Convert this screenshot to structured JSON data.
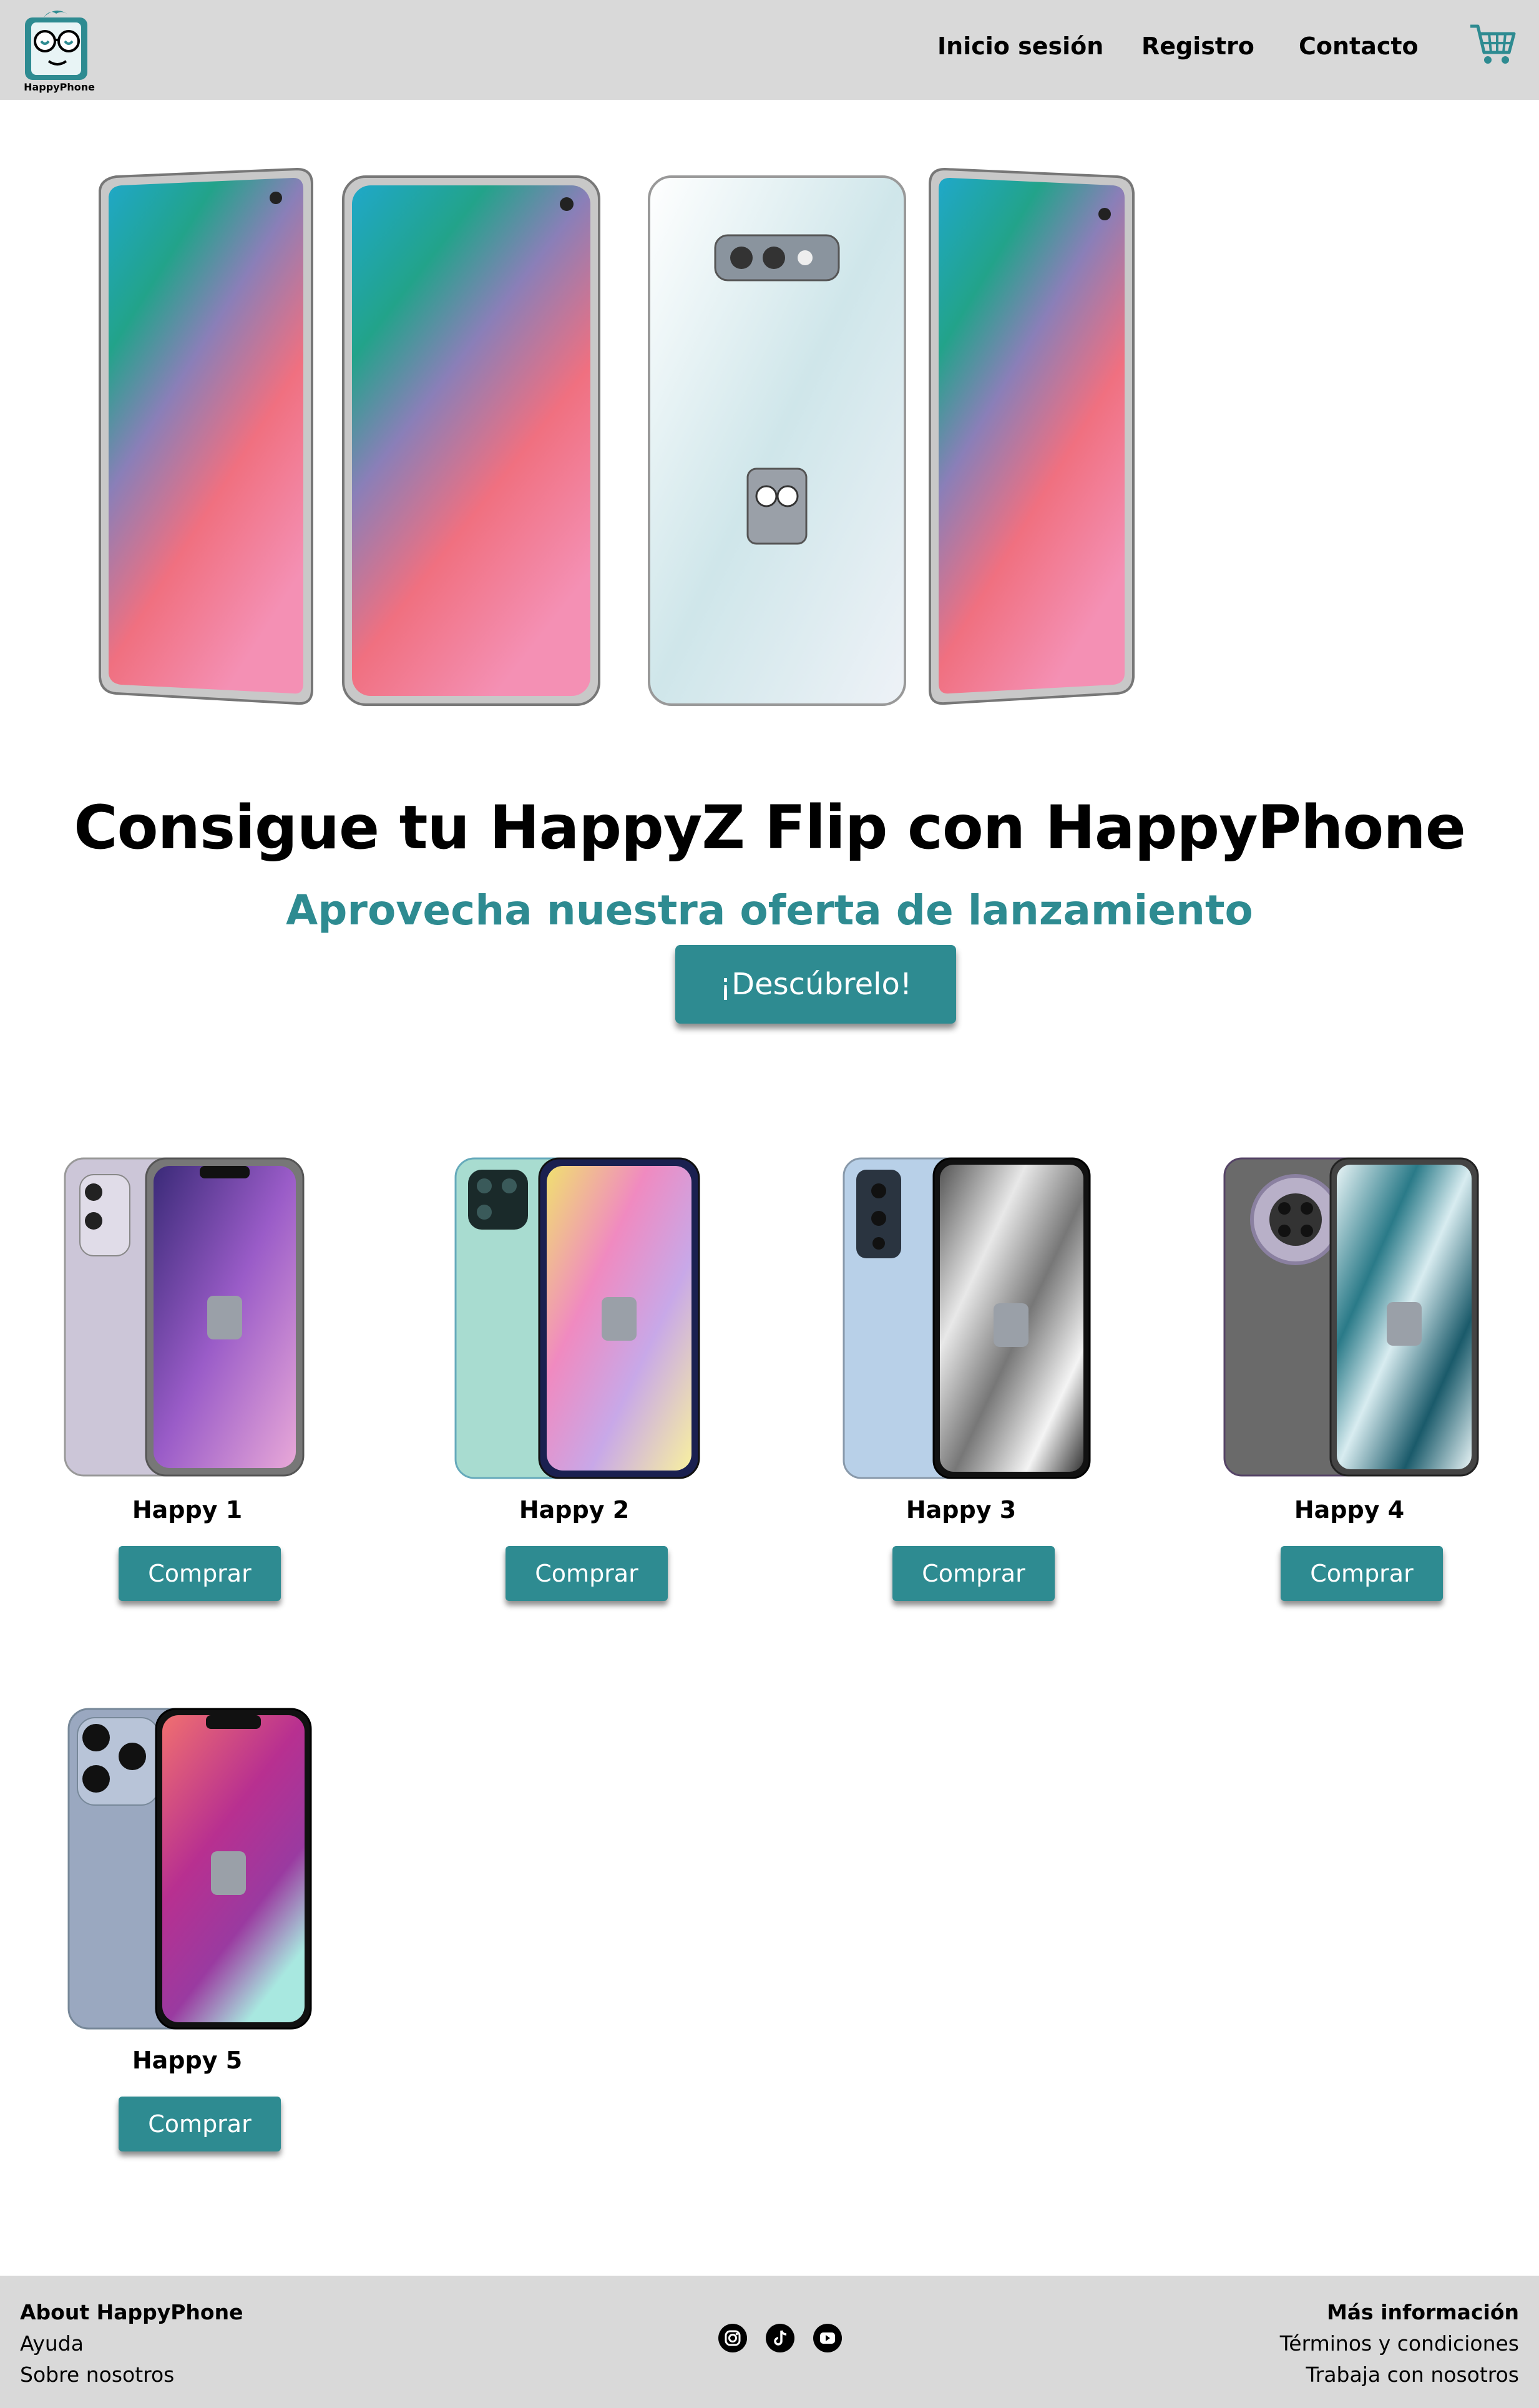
{
  "header": {
    "logo_text": "HappyPhone",
    "nav": [
      "Inicio sesión",
      "Registro",
      "Contacto"
    ],
    "cart_icon": "shopping-cart-icon",
    "accent": "#2e8b91"
  },
  "hero": {
    "title": "Consigue tu HappyZ Flip con HappyPhone",
    "subtitle": "Aprovecha nuestra oferta de lanzamiento",
    "cta": "¡Descúbrelo!"
  },
  "products": [
    {
      "name": "Happy 1",
      "button": "Comprar"
    },
    {
      "name": "Happy 2",
      "button": "Comprar"
    },
    {
      "name": "Happy 3",
      "button": "Comprar"
    },
    {
      "name": "Happy 4",
      "button": "Comprar"
    },
    {
      "name": "Happy 5",
      "button": "Comprar"
    }
  ],
  "footer": {
    "left_heading": "About HappyPhone",
    "left_links": [
      "Ayuda",
      "Sobre nosotros"
    ],
    "socials": [
      "instagram-icon",
      "tiktok-icon",
      "youtube-icon"
    ],
    "right_heading": "Más información",
    "right_links": [
      "Términos y condiciones",
      "Trabaja con nosotros"
    ]
  }
}
